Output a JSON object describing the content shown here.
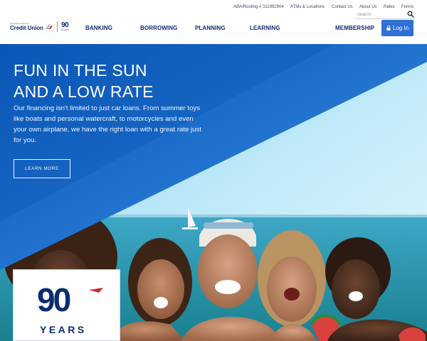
{
  "brand": {
    "org_small": "American Airlines",
    "name": "Credit Union",
    "anniversary_number": "90",
    "anniversary_word": "YEARS"
  },
  "utility_nav": {
    "routing": "ABA/Routing # 311992904",
    "atms": "ATMs & Locations",
    "contact": "Contact Us",
    "about": "About Us",
    "rates": "Rates",
    "forms": "Forms"
  },
  "search": {
    "placeholder": "Search",
    "icon": "search-icon"
  },
  "main_nav": {
    "banking": "BANKING",
    "borrowing": "BORROWING",
    "planning": "PLANNING",
    "learning": "LEARNING",
    "membership": "MEMBERSHIP",
    "login": "Log In",
    "login_icon": "lock-icon"
  },
  "hero": {
    "title_line1": "FUN IN THE SUN",
    "title_line2": "AND A LOW RATE",
    "body": "Our financing isn't limited to just car loans. From summer toys like boats and personal watercraft, to motorcycles and even your own airplane, we have the right loan with a great rate just for you.",
    "cta": "LEARN MORE"
  },
  "badge": {
    "number": "90",
    "word": "YEARS"
  },
  "colors": {
    "brand_navy": "#0c2c72",
    "login_blue": "#2f6fd6",
    "hero_blue": "#1a63c6",
    "accent_red": "#d2232a"
  }
}
